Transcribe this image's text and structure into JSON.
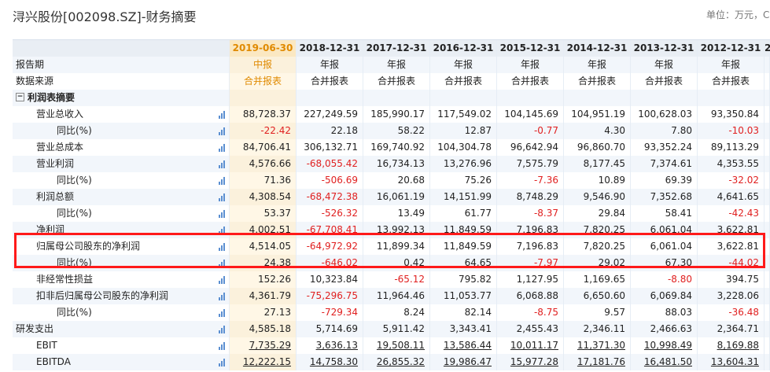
{
  "title": "浔兴股份[002098.SZ]-财务摘要",
  "unit": "单位：万元，C",
  "periods": [
    "2019-06-30",
    "2018-12-31",
    "2017-12-31",
    "2016-12-31",
    "2015-12-31",
    "2014-12-31",
    "2013-12-31",
    "2012-12-31",
    "2"
  ],
  "report_period": {
    "label": "报告期",
    "values": [
      "中报",
      "年报",
      "年报",
      "年报",
      "年报",
      "年报",
      "年报",
      "年报"
    ]
  },
  "data_source": {
    "label": "数据来源",
    "values": [
      "合并报表",
      "合并报表",
      "合并报表",
      "合并报表",
      "合并报表",
      "合并报表",
      "合并报表",
      "合并报表"
    ]
  },
  "section": {
    "toggle": "−",
    "label": "利润表摘要"
  },
  "rows": [
    {
      "label": "营业总收入",
      "indent": 1,
      "values": [
        "88,728.37",
        "227,249.59",
        "185,990.17",
        "117,549.02",
        "104,145.69",
        "104,951.19",
        "100,628.03",
        "93,350.84"
      ]
    },
    {
      "label": "同比(%)",
      "indent": 2,
      "values": [
        "-22.42",
        "22.18",
        "58.22",
        "12.87",
        "-0.77",
        "4.30",
        "7.80",
        "-10.03"
      ]
    },
    {
      "label": "营业总成本",
      "indent": 1,
      "values": [
        "84,706.41",
        "306,132.71",
        "169,740.92",
        "104,304.78",
        "96,642.94",
        "96,860.70",
        "93,352.24",
        "89,113.29"
      ]
    },
    {
      "label": "营业利润",
      "indent": 1,
      "values": [
        "4,576.66",
        "-68,055.42",
        "16,734.13",
        "13,276.96",
        "7,575.79",
        "8,177.45",
        "7,374.61",
        "4,353.55"
      ]
    },
    {
      "label": "同比(%)",
      "indent": 2,
      "values": [
        "71.36",
        "-506.69",
        "20.68",
        "75.26",
        "-7.36",
        "10.89",
        "69.39",
        "-32.02"
      ]
    },
    {
      "label": "利润总额",
      "indent": 1,
      "values": [
        "4,308.54",
        "-68,472.38",
        "16,061.19",
        "14,151.99",
        "8,748.29",
        "9,546.90",
        "7,352.68",
        "4,641.65"
      ]
    },
    {
      "label": "同比(%)",
      "indent": 2,
      "values": [
        "53.37",
        "-526.32",
        "13.49",
        "61.77",
        "-8.37",
        "29.84",
        "58.41",
        "-42.43"
      ]
    },
    {
      "label": "净利润",
      "indent": 1,
      "values": [
        "4,002.51",
        "-67,708.41",
        "13,992.13",
        "11,849.59",
        "7,196.83",
        "7,820.25",
        "6,061.04",
        "3,622.81"
      ]
    },
    {
      "label": "归属母公司股东的净利润",
      "indent": 1,
      "values": [
        "4,514.05",
        "-64,972.92",
        "11,899.34",
        "11,849.59",
        "7,196.83",
        "7,820.25",
        "6,061.04",
        "3,622.81"
      ]
    },
    {
      "label": "同比(%)",
      "indent": 2,
      "values": [
        "24.38",
        "-646.02",
        "0.42",
        "64.65",
        "-7.97",
        "29.02",
        "67.30",
        "-44.02"
      ]
    },
    {
      "label": "非经常性损益",
      "indent": 1,
      "values": [
        "152.26",
        "10,323.84",
        "-65.12",
        "795.82",
        "1,127.95",
        "1,169.65",
        "-8.80",
        "394.75"
      ]
    },
    {
      "label": "扣非后归属母公司股东的净利润",
      "indent": 1,
      "values": [
        "4,361.79",
        "-75,296.75",
        "11,964.46",
        "11,053.77",
        "6,068.88",
        "6,650.60",
        "6,069.84",
        "3,228.06"
      ]
    },
    {
      "label": "同比(%)",
      "indent": 2,
      "values": [
        "27.13",
        "-729.34",
        "8.24",
        "82.14",
        "-8.75",
        "9.57",
        "88.03",
        "-36.48"
      ]
    },
    {
      "label": "研发支出",
      "indent": 0,
      "values": [
        "4,585.18",
        "5,714.69",
        "5,911.42",
        "3,343.41",
        "2,455.43",
        "2,346.11",
        "2,466.63",
        "2,364.71"
      ]
    },
    {
      "label": "EBIT",
      "indent": 1,
      "underline": true,
      "values": [
        "7,735.29",
        "3,636.13",
        "19,508.11",
        "13,586.44",
        "10,011.17",
        "11,371.30",
        "10,998.49",
        "8,169.88"
      ]
    },
    {
      "label": "EBITDA",
      "indent": 1,
      "underline": true,
      "values": [
        "12,222.15",
        "14,758.30",
        "26,855.32",
        "19,986.47",
        "15,977.28",
        "17,181.76",
        "16,481.50",
        "13,604.31"
      ]
    }
  ],
  "colors": {
    "negative": "#e02020",
    "accent": "#e08a00",
    "highlight": "#ff1a1a"
  }
}
